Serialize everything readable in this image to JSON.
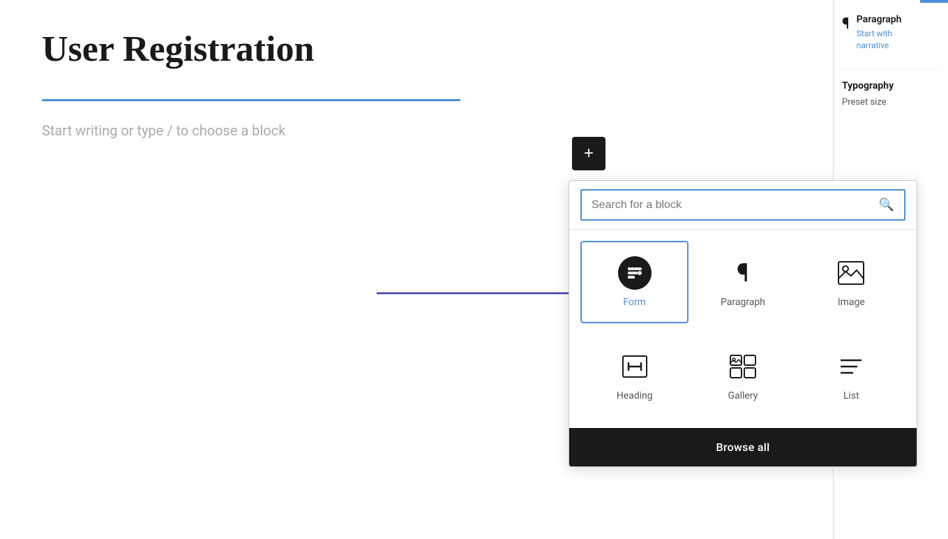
{
  "page": {
    "title": "User Registration",
    "placeholder": "Start writing or type / to choose a block",
    "divider_color": "#4a90d9"
  },
  "add_button": {
    "label": "+"
  },
  "block_picker": {
    "search_placeholder": "Search for a block",
    "blocks": [
      {
        "id": "form",
        "label": "Form",
        "icon_type": "form",
        "selected": true
      },
      {
        "id": "paragraph",
        "label": "Paragraph",
        "icon_type": "paragraph",
        "selected": false
      },
      {
        "id": "image",
        "label": "Image",
        "icon_type": "image",
        "selected": false
      },
      {
        "id": "heading",
        "label": "Heading",
        "icon_type": "heading",
        "selected": false
      },
      {
        "id": "gallery",
        "label": "Gallery",
        "icon_type": "gallery",
        "selected": false
      },
      {
        "id": "list",
        "label": "List",
        "icon_type": "list",
        "selected": false
      }
    ],
    "browse_all_label": "Browse all"
  },
  "right_panel": {
    "paragraph_title": "Paragraph",
    "paragraph_desc": "Start with\nnarrative",
    "typography_label": "Typography",
    "preset_size_label": "Preset size"
  }
}
